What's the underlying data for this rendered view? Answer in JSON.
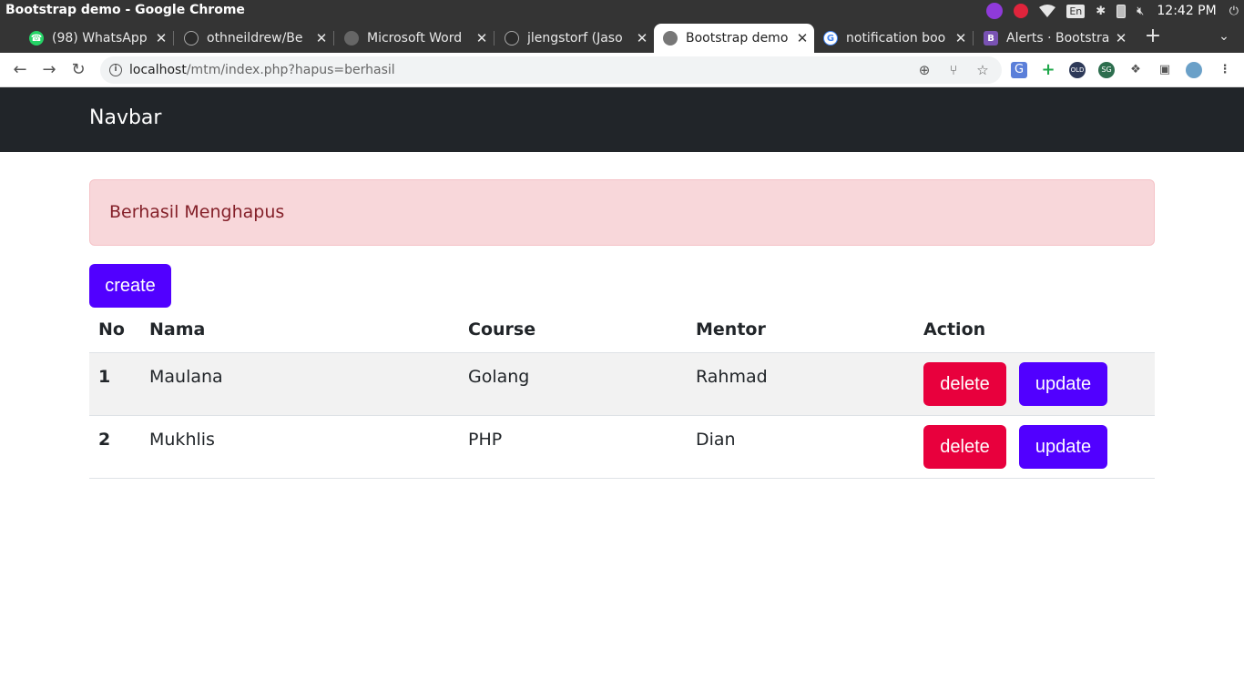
{
  "window": {
    "title": "Bootstrap demo - Google Chrome"
  },
  "tray": {
    "time": "12:42 PM",
    "lang": "En"
  },
  "tabs": [
    {
      "title": "(98) WhatsApp",
      "favicon": "whatsapp-icon",
      "color": "#25d366",
      "active": false
    },
    {
      "title": "othneildrew/Be",
      "favicon": "github-icon",
      "color": "#2b2b2b",
      "active": false
    },
    {
      "title": "Microsoft Word",
      "favicon": "globe-icon",
      "color": "#555555",
      "active": false
    },
    {
      "title": "jlengstorf (Jaso",
      "favicon": "github-icon",
      "color": "#2b2b2b",
      "active": false
    },
    {
      "title": "Bootstrap demo",
      "favicon": "globe-icon",
      "color": "#555555",
      "active": true
    },
    {
      "title": "notification boo",
      "favicon": "google-icon",
      "color": "#4285f4",
      "active": false
    },
    {
      "title": "Alerts · Bootstra",
      "favicon": "bootstrap-icon",
      "color": "#7952b3",
      "active": false
    }
  ],
  "address": {
    "host": "localhost",
    "path": "/mtm/index.php?hapus=berhasil"
  },
  "navbar": {
    "brand": "Navbar"
  },
  "alert": {
    "message": "Berhasil Menghapus"
  },
  "actions": {
    "create_label": "create"
  },
  "table": {
    "headers": [
      "No",
      "Nama",
      "Course",
      "Mentor",
      "Action"
    ],
    "rows": [
      {
        "no": "1",
        "nama": "Maulana",
        "course": "Golang",
        "mentor": "Rahmad",
        "delete": "delete",
        "update": "update"
      },
      {
        "no": "2",
        "nama": "Mukhlis",
        "course": "PHP",
        "mentor": "Dian",
        "delete": "delete",
        "update": "update"
      }
    ]
  },
  "colors": {
    "primary": "#5100ff",
    "danger": "#e8003d",
    "navbar": "#212529",
    "alert_bg": "#f8d7da",
    "alert_text": "#842029"
  }
}
